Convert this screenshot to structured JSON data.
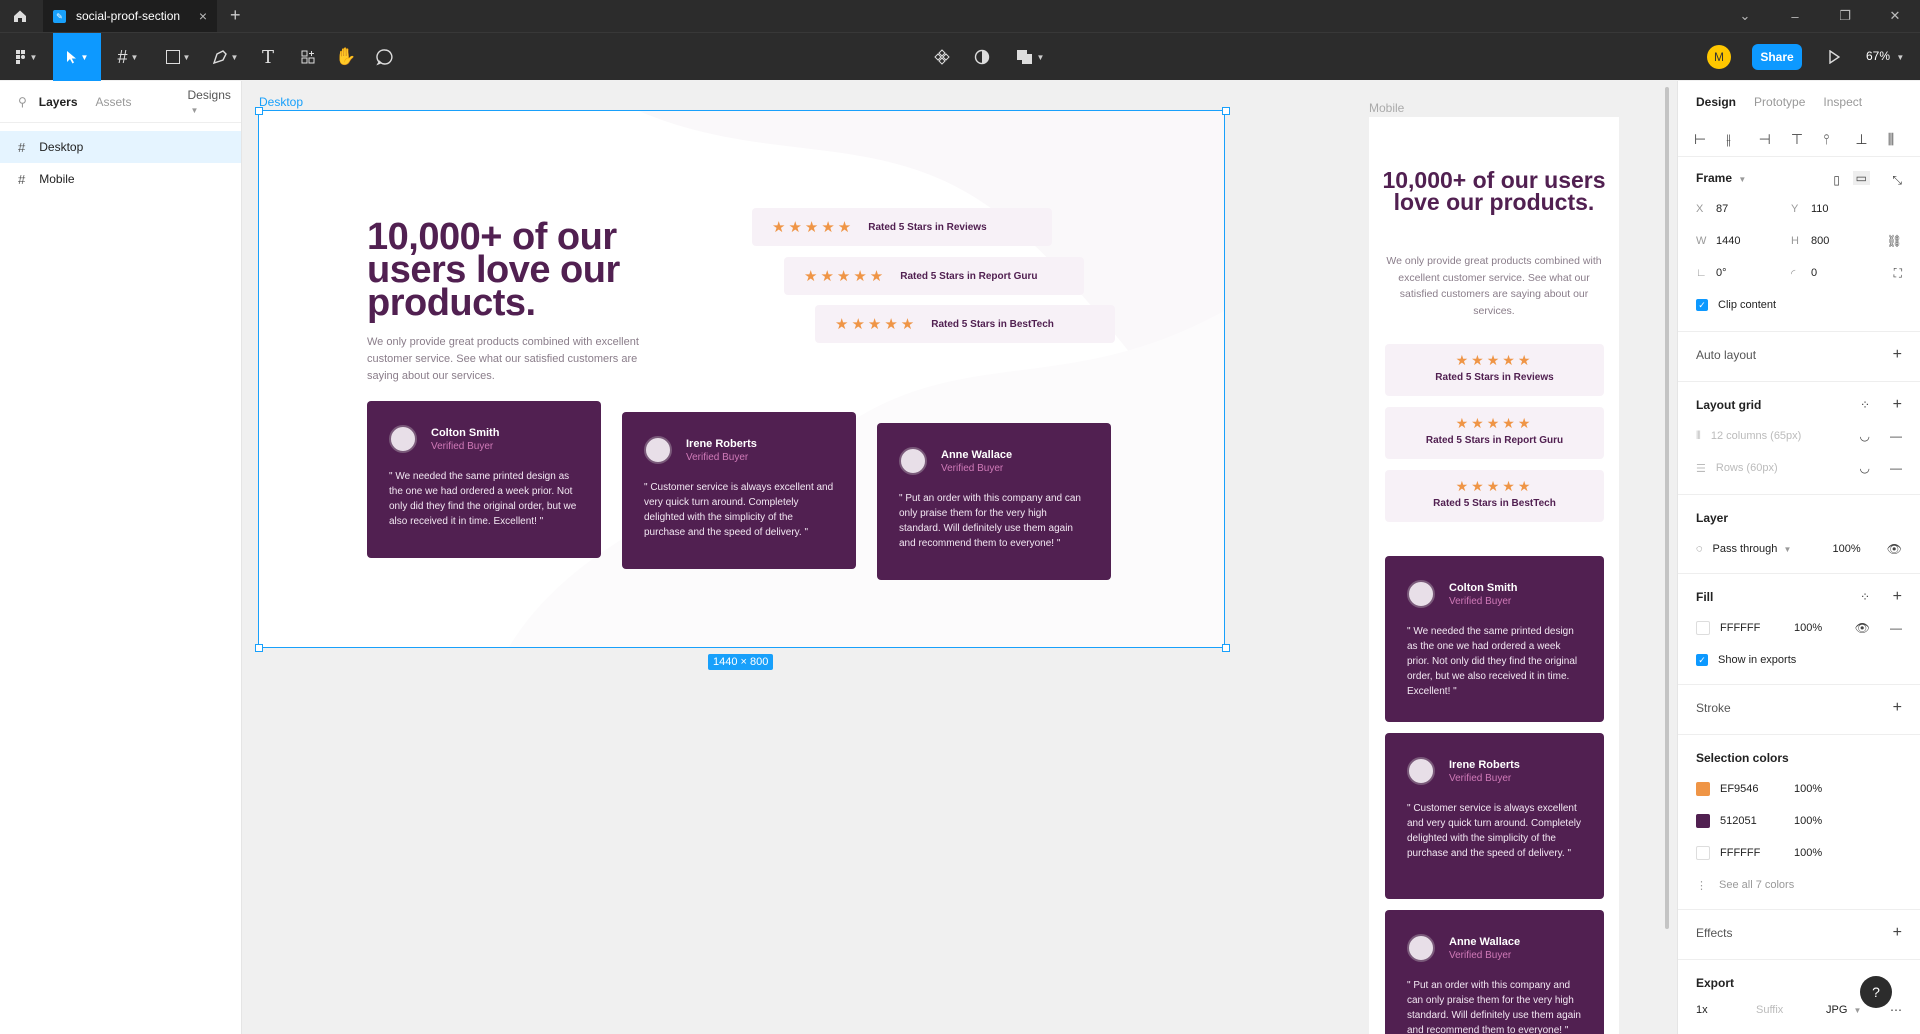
{
  "window": {
    "tab_title": "social-proof-section",
    "min_glyph": "–",
    "restore_glyph": "❐",
    "close_glyph": "✕",
    "chevron_glyph": "⌄"
  },
  "toolbar": {
    "avatar_initial": "M",
    "share_label": "Share",
    "zoom_label": "67%"
  },
  "left_panel": {
    "tabs": [
      "Layers",
      "Assets"
    ],
    "pages_label": "Designs",
    "layers": [
      {
        "label": "Desktop",
        "selected": true
      },
      {
        "label": "Mobile",
        "selected": false
      }
    ]
  },
  "canvas": {
    "desktop_label": "Desktop",
    "mobile_label": "Mobile",
    "size_badge": "1440 × 800",
    "headline": "10,000+ of our users love our products.",
    "description": "We only provide great products combined with excellent customer service. See what our satisfied customers are saying about our services.",
    "stars": "★★★★★",
    "ratings": [
      "Rated 5 Stars in Reviews",
      "Rated 5 Stars in Report Guru",
      "Rated 5 Stars in BestTech"
    ],
    "testimonials": [
      {
        "name": "Colton Smith",
        "role": "Verified Buyer",
        "quote": "\" We needed the same printed design as the one we had ordered a week prior. Not only did they find the original order, but we also received it in time. Excellent! \""
      },
      {
        "name": "Irene Roberts",
        "role": "Verified Buyer",
        "quote": "\" Customer service is always excellent and very quick turn around. Completely delighted with the simplicity of the purchase and the speed of delivery. \""
      },
      {
        "name": "Anne Wallace",
        "role": "Verified Buyer",
        "quote": "\" Put an order with this company and can only praise them for the very high standard. Will definitely use them again and recommend them to everyone! \""
      }
    ],
    "colors": {
      "purple": "#512051",
      "orange": "#EF9546",
      "white": "#FFFFFF",
      "selection": "#18A0FB"
    }
  },
  "right_panel": {
    "tabs": [
      "Design",
      "Prototype",
      "Inspect"
    ],
    "frame": {
      "title": "Frame",
      "x_label": "X",
      "x": "87",
      "y_label": "Y",
      "y": "110",
      "w_label": "W",
      "w": "1440",
      "h_label": "H",
      "h": "800",
      "rotation": "0°",
      "radius": "0",
      "clip_label": "Clip content"
    },
    "auto_layout": "Auto layout",
    "layout_grid": {
      "title": "Layout grid",
      "columns": "12 columns (65px)",
      "rows": "Rows (60px)"
    },
    "layer": {
      "title": "Layer",
      "blend": "Pass through",
      "opacity": "100%"
    },
    "fill": {
      "title": "Fill",
      "hex": "FFFFFF",
      "opacity": "100%",
      "export_label": "Show in exports"
    },
    "stroke": "Stroke",
    "selection_colors": {
      "title": "Selection colors",
      "items": [
        {
          "hex": "EF9546",
          "opacity": "100%"
        },
        {
          "hex": "512051",
          "opacity": "100%"
        },
        {
          "hex": "FFFFFF",
          "opacity": "100%"
        }
      ],
      "see_all": "See all 7 colors"
    },
    "effects": "Effects",
    "export": {
      "title": "Export",
      "scale": "1x",
      "suffix": "Suffix",
      "format": "JPG"
    }
  }
}
